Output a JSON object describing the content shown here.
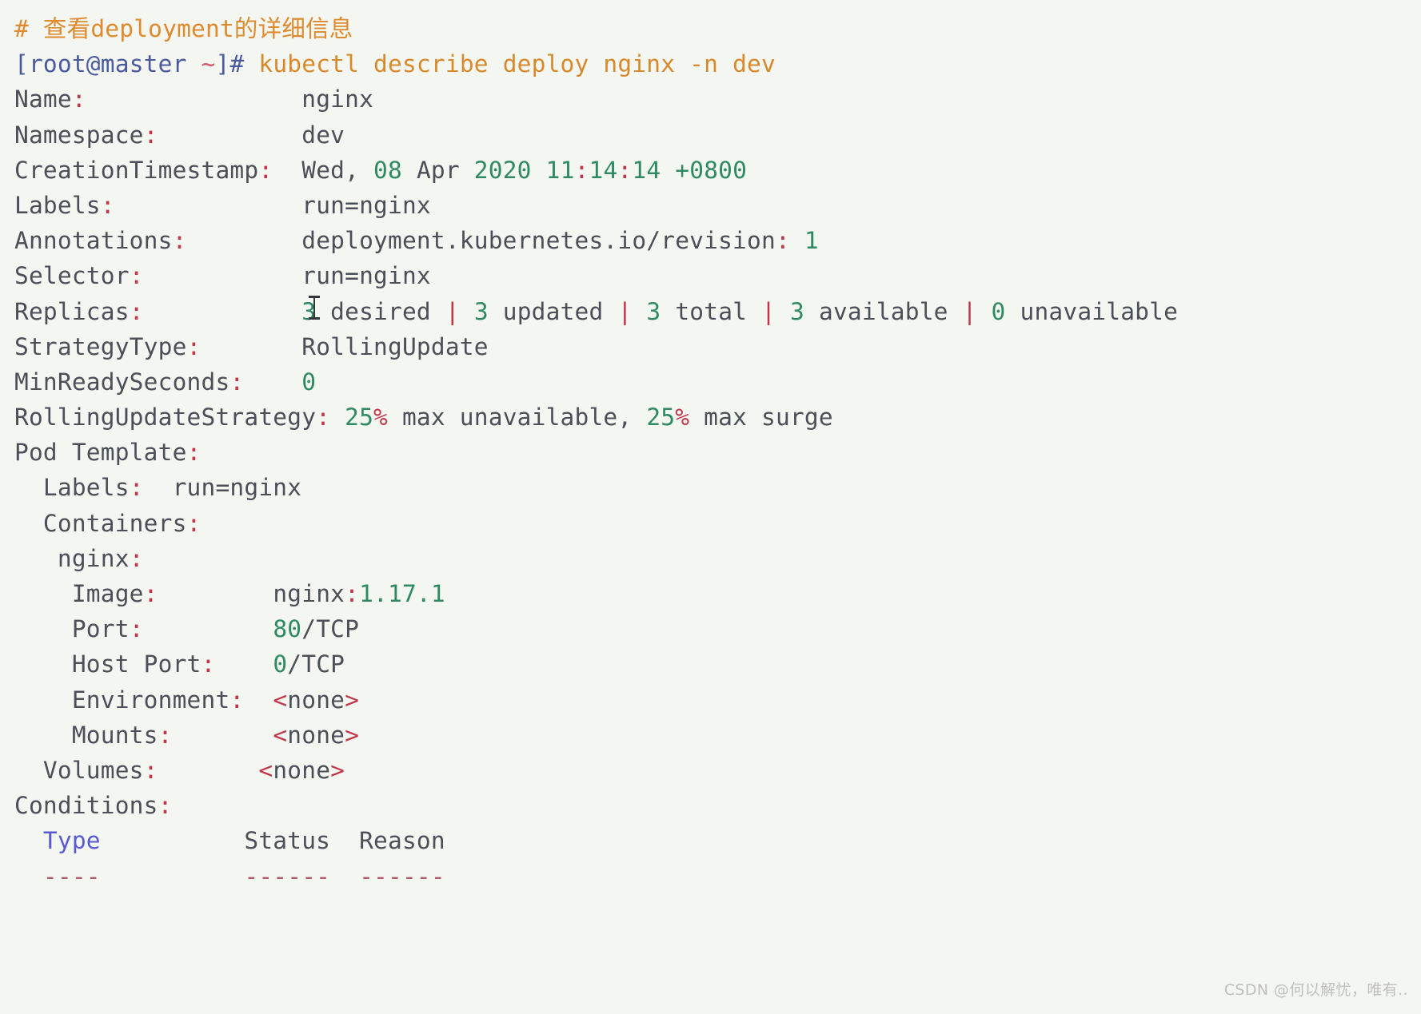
{
  "terminal": {
    "background": "#f4f6f2",
    "colors": {
      "comment": "#e08a2e",
      "prompt": "#4a5a9c",
      "tilde": "#d05b6a",
      "command": "#d8892b",
      "key": "#4a4f58",
      "colon": "#c2364a",
      "value": "#4a4f58",
      "number": "#2f8a63",
      "punct": "#c2364a",
      "type_header": "#5a5ad0",
      "dash": "#b05a6a"
    },
    "comment_line": "# 查看deployment的详细信息",
    "prompt": {
      "open_bracket": "[",
      "user_host": "root@master",
      "space": " ",
      "tilde": "~",
      "close_bracket": "]#",
      "command": " kubectl describe deploy nginx -n dev"
    },
    "fields": {
      "name_key": "Name",
      "name_value": "nginx",
      "namespace_key": "Namespace",
      "namespace_value": "dev",
      "creation_key": "CreationTimestamp",
      "creation_value": "Wed, 08 Apr 2020 11:14:14 +0800",
      "creation_parts": {
        "day": "Wed,",
        "date": "08",
        "month": "Apr",
        "year": "2020",
        "hour": "11",
        "minute": "14",
        "second": "14",
        "offset": "+0800"
      },
      "labels_key": "Labels",
      "labels_value": "run=nginx",
      "annotations_key": "Annotations",
      "annotations_value": "deployment.kubernetes.io/revision: 1",
      "annotations_name": "deployment.kubernetes.io/revision",
      "annotations_revision": "1",
      "selector_key": "Selector",
      "selector_value": "run=nginx",
      "replicas_key": "Replicas",
      "replicas_desired": "3",
      "replicas_desired_label": "desired",
      "replicas_updated": "3",
      "replicas_updated_label": "updated",
      "replicas_total": "3",
      "replicas_total_label": "total",
      "replicas_available": "3",
      "replicas_available_label": "available",
      "replicas_unavailable": "0",
      "replicas_unavailable_label": "unavailable",
      "pipe": "|",
      "strategytype_key": "StrategyType",
      "strategytype_value": "RollingUpdate",
      "minreadyseconds_key": "MinReadySeconds",
      "minreadyseconds_value": "0",
      "rollingupdate_key": "RollingUpdateStrategy",
      "rollingupdate_max_unavailable_num": "25",
      "rollingupdate_percent": "%",
      "rollingupdate_max_unavailable_label": "max unavailable,",
      "rollingupdate_max_surge_num": "25",
      "rollingupdate_max_surge_label": "max surge",
      "pod_template_key": "Pod Template",
      "pod_labels_key": "Labels",
      "pod_labels_value": "run=nginx",
      "containers_key": "Containers",
      "container_name": "nginx",
      "image_key": "Image",
      "image_name": "nginx",
      "image_tag": "1.17.1",
      "port_key": "Port",
      "port_num": "80",
      "port_proto": "/TCP",
      "host_port_key": "Host Port",
      "host_port_num": "0",
      "host_port_proto": "/TCP",
      "environment_key": "Environment",
      "environment_value": "none",
      "mounts_key": "Mounts",
      "mounts_value": "none",
      "volumes_key": "Volumes",
      "volumes_value": "none",
      "conditions_key": "Conditions",
      "col_type": "Type",
      "col_status": "Status",
      "col_reason": "Reason",
      "dash_type": "----",
      "dash_status": "------",
      "dash_reason": "------",
      "angle_open": "<",
      "angle_close": ">"
    }
  },
  "watermark": "CSDN @何以解忧，唯有.."
}
